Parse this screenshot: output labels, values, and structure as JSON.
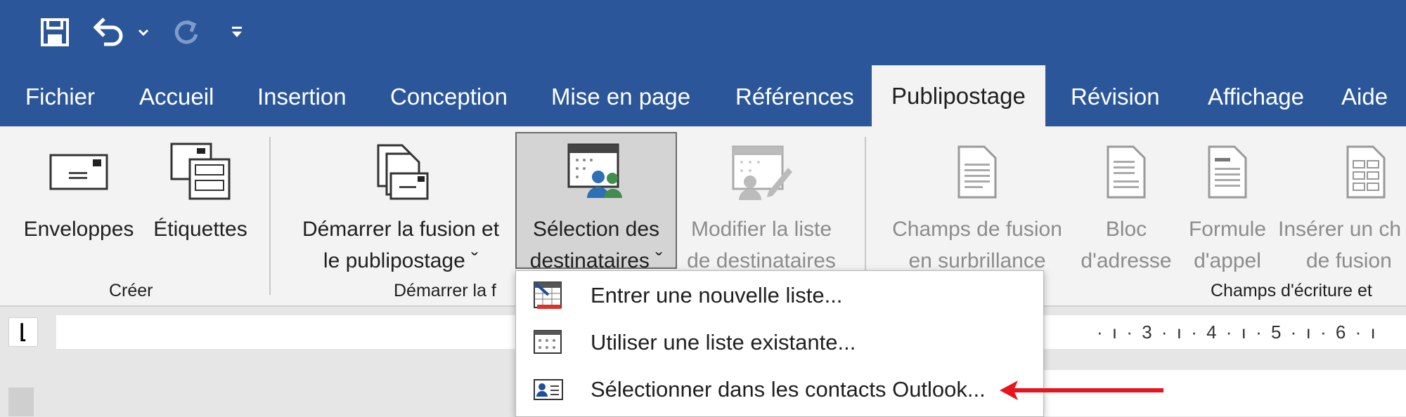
{
  "quick_access": {
    "icons": [
      "save-icon",
      "undo-icon",
      "undo-dropdown-icon",
      "redo-icon",
      "customize-qat-icon"
    ]
  },
  "tabs": [
    {
      "label": "Fichier"
    },
    {
      "label": "Accueil"
    },
    {
      "label": "Insertion"
    },
    {
      "label": "Conception"
    },
    {
      "label": "Mise en page"
    },
    {
      "label": "Références"
    },
    {
      "label": "Publipostage",
      "active": true
    },
    {
      "label": "Révision"
    },
    {
      "label": "Affichage"
    },
    {
      "label": "Aide"
    }
  ],
  "ribbon": {
    "groups": {
      "creer": {
        "label": "Créer",
        "buttons": [
          {
            "line1": "Enveloppes",
            "line2": ""
          },
          {
            "line1": "Étiquettes",
            "line2": ""
          }
        ]
      },
      "demarrer": {
        "label": "Démarrer la f",
        "buttons": [
          {
            "line1": "Démarrer la fusion et",
            "line2": "le publipostage ˇ"
          },
          {
            "line1": "Sélection des",
            "line2": "destinataires ˇ",
            "pressed": true
          },
          {
            "line1": "Modifier la liste",
            "line2": "de destinataires",
            "disabled": true
          }
        ]
      },
      "champs": {
        "label": "Champs d'écriture et",
        "buttons": [
          {
            "line1": "Champs de fusion",
            "line2": "en surbrillance",
            "disabled": true
          },
          {
            "line1": "Bloc",
            "line2": "d'adresse",
            "disabled": true
          },
          {
            "line1": "Formule",
            "line2": "d'appel",
            "disabled": true
          },
          {
            "line1": "Insérer un ch",
            "line2": "de fusion",
            "disabled": true
          }
        ]
      }
    }
  },
  "dropdown": {
    "items": [
      {
        "label": "Entrer une nouvelle liste...",
        "icon": "new-list-icon"
      },
      {
        "label": "Utiliser une liste existante...",
        "icon": "existing-list-icon"
      },
      {
        "label": "Sélectionner dans les contacts Outlook...",
        "icon": "outlook-contacts-icon",
        "highlighted_by_arrow": true
      }
    ]
  },
  "ruler": {
    "ticks": "· ı · 3 · ı · 4 · ı · 5 · ı · 6 · ı"
  },
  "colors": {
    "title_bar": "#2b579a",
    "ribbon_bg": "#f3f3f3",
    "arrow": "#e8141b"
  }
}
